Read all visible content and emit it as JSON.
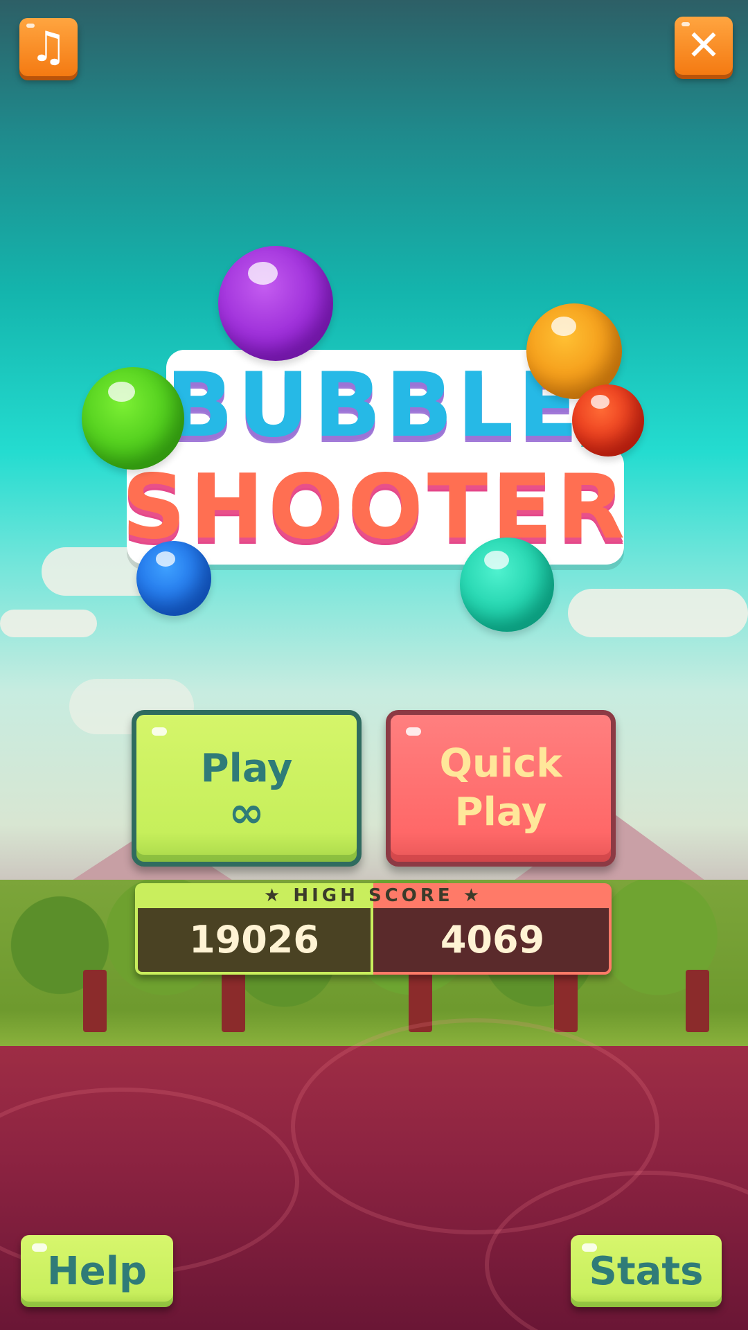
{
  "game": {
    "title_line1": "BUBBLE",
    "title_line2": "SHOOTER"
  },
  "top_bar": {
    "music_icon": "♫",
    "close_icon": "✕"
  },
  "menu": {
    "play_label": "Play",
    "play_mode_symbol": "∞",
    "quick_play_line1": "Quick",
    "quick_play_line2": "Play"
  },
  "high_score": {
    "label": "★ HIGH SCORE ★",
    "play_value": "19026",
    "quick_play_value": "4069"
  },
  "bottom_bar": {
    "help_label": "Help",
    "stats_label": "Stats"
  },
  "colors": {
    "play_button": "#c6ef5b",
    "quick_play_button": "#ff6868",
    "accent_orange": "#f47a12"
  }
}
